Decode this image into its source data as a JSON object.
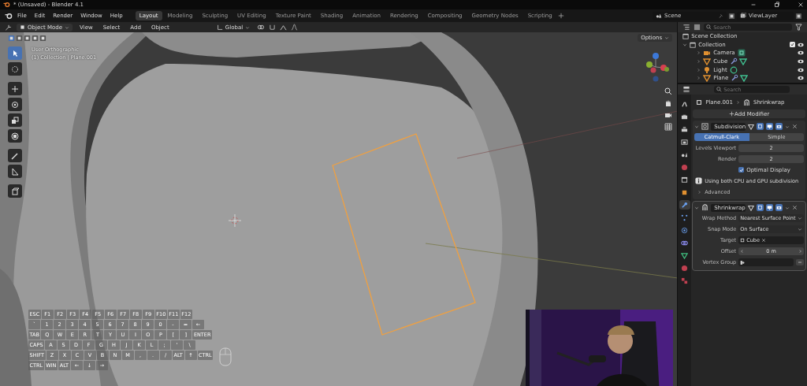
{
  "window": {
    "title": "* (Unsaved) - Blender 4.1"
  },
  "menu": [
    "File",
    "Edit",
    "Render",
    "Window",
    "Help"
  ],
  "workspaces": [
    {
      "label": "Layout",
      "selected": true
    },
    {
      "label": "Modeling",
      "selected": false
    },
    {
      "label": "Sculpting",
      "selected": false
    },
    {
      "label": "UV Editing",
      "selected": false
    },
    {
      "label": "Texture Paint",
      "selected": false
    },
    {
      "label": "Shading",
      "selected": false
    },
    {
      "label": "Animation",
      "selected": false
    },
    {
      "label": "Rendering",
      "selected": false
    },
    {
      "label": "Compositing",
      "selected": false
    },
    {
      "label": "Geometry Nodes",
      "selected": false
    },
    {
      "label": "Scripting",
      "selected": false
    }
  ],
  "scene": "Scene",
  "view_layer": "ViewLayer",
  "viewport_header": {
    "mode": "Object Mode",
    "menus": [
      "View",
      "Select",
      "Add",
      "Object"
    ],
    "orientation": "Global"
  },
  "viewport": {
    "view_name": "User Orthographic",
    "context": "(1) Collection | Plane.001",
    "options": "Options"
  },
  "outliner": {
    "search_placeholder": "Search",
    "root": "Scene Collection",
    "collection": {
      "label": "Collection",
      "checked": true,
      "children": [
        {
          "label": "Camera",
          "kind": "camera"
        },
        {
          "label": "Cube",
          "kind": "mesh"
        },
        {
          "label": "Light",
          "kind": "light"
        },
        {
          "label": "Plane",
          "kind": "mesh"
        }
      ]
    }
  },
  "properties": {
    "search_placeholder": "Search",
    "object": "Plane.001",
    "modifier": "Shrinkwrap",
    "add_modifier": "Add Modifier",
    "tabs": [
      {
        "kind": "tool",
        "selected": false
      },
      {
        "kind": "render",
        "selected": false
      },
      {
        "kind": "output",
        "selected": false
      },
      {
        "kind": "view",
        "selected": false
      },
      {
        "kind": "scene",
        "selected": false
      },
      {
        "kind": "world",
        "selected": false
      },
      {
        "kind": "collection",
        "selected": false
      },
      {
        "kind": "object",
        "selected": false
      },
      {
        "kind": "modifier",
        "selected": true
      },
      {
        "kind": "particles",
        "selected": false
      },
      {
        "kind": "physics",
        "selected": false
      },
      {
        "kind": "constraints",
        "selected": false
      },
      {
        "kind": "data",
        "selected": false
      },
      {
        "kind": "material",
        "selected": false
      },
      {
        "kind": "texture",
        "selected": false
      }
    ],
    "modifiers": [
      {
        "name": "Subdivision",
        "kind": "subdivision",
        "rows": [
          {
            "kind": "tabs",
            "options": [
              {
                "label": "Catmull-Clark",
                "selected": true
              },
              {
                "label": "Simple",
                "selected": false
              }
            ]
          },
          {
            "kind": "number",
            "label": "Levels Viewport",
            "value": "2"
          },
          {
            "kind": "number",
            "label": "Render",
            "value": "2"
          },
          {
            "kind": "checkbox",
            "label": "Optimal Display",
            "checked": true
          },
          {
            "kind": "info",
            "label": "Using both CPU and GPU subdivision"
          },
          {
            "kind": "subpanel",
            "label": "Advanced"
          }
        ]
      },
      {
        "name": "Shrinkwrap",
        "kind": "shrinkwrap",
        "rows": [
          {
            "kind": "dropdown",
            "label": "Wrap Method",
            "value": "Nearest Surface Point"
          },
          {
            "kind": "dropdown",
            "label": "Snap Mode",
            "value": "On Surface"
          },
          {
            "kind": "object",
            "label": "Target",
            "value": "Cube"
          },
          {
            "kind": "slider",
            "label": "Offset",
            "value": "0 m"
          },
          {
            "kind": "vgroup",
            "label": "Vertex Group"
          }
        ]
      }
    ]
  },
  "key_overlay": {
    "rows": [
      [
        "ESC",
        "F1",
        "F2",
        "F3",
        "F4",
        "F5",
        "F6",
        "F7",
        "F8",
        "F9",
        "F10",
        "F11",
        "F12"
      ],
      [
        "`",
        "1",
        "2",
        "3",
        "4",
        "5",
        "6",
        "7",
        "8",
        "9",
        "0",
        "-",
        "=",
        "←"
      ],
      [
        "TAB",
        "Q",
        "W",
        "E",
        "R",
        "T",
        "Y",
        "U",
        "I",
        "O",
        "P",
        "[",
        "]",
        "ENTER"
      ],
      [
        "CAPS",
        "A",
        "S",
        "D",
        "F",
        "G",
        "H",
        "J",
        "K",
        "L",
        ";",
        "'",
        "\\"
      ],
      [
        "SHIFT",
        "Z",
        "X",
        "C",
        "V",
        "B",
        "N",
        "M",
        ",",
        ".",
        "/",
        "ALT",
        "↑",
        "CTRL"
      ],
      [
        "CTRL",
        "WIN",
        "ALT",
        "←",
        "↓",
        "→"
      ]
    ]
  }
}
